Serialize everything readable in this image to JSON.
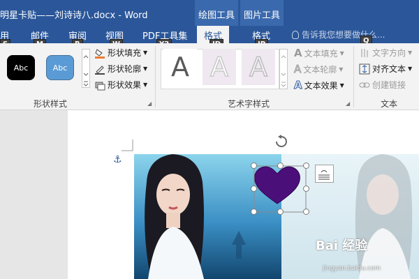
{
  "window": {
    "title": "明星卡贴——刘诗诗八.docx - Word",
    "context_tabs": [
      "绘图工具",
      "图片工具"
    ]
  },
  "tabs": [
    {
      "label": "用"
    },
    {
      "label": "邮件"
    },
    {
      "label": "审阅"
    },
    {
      "label": "视图"
    },
    {
      "label": "PDF工具集"
    },
    {
      "label": "格式",
      "active": true
    },
    {
      "label": "格式"
    }
  ],
  "tell_me": "告诉我您想要做什么...",
  "keytips": [
    "S",
    "M",
    "R",
    "W",
    "Y2",
    "JD",
    "JP",
    "Q"
  ],
  "ribbon": {
    "shape_styles": {
      "label": "形状样式",
      "samples": [
        {
          "text": "Abc",
          "color": "#000000"
        },
        {
          "text": "Abc",
          "color": "#5b9bd5"
        }
      ],
      "commands": [
        "形状填充",
        "形状轮廓",
        "形状效果"
      ]
    },
    "wordart_styles": {
      "label": "艺术字样式",
      "letter": "A",
      "commands": [
        "文本填充",
        "文本轮廓",
        "文本效果"
      ]
    },
    "text": {
      "label": "文本",
      "commands": [
        "文字方向",
        "对齐文本",
        "创建链接"
      ]
    }
  },
  "colors": {
    "titlebar": "#2b579a",
    "heart": "#4b0f7a",
    "selection_handle": "#7a7a7a"
  },
  "watermark": "Bai 经验",
  "watermark_url": "jingyan.baidu.com"
}
